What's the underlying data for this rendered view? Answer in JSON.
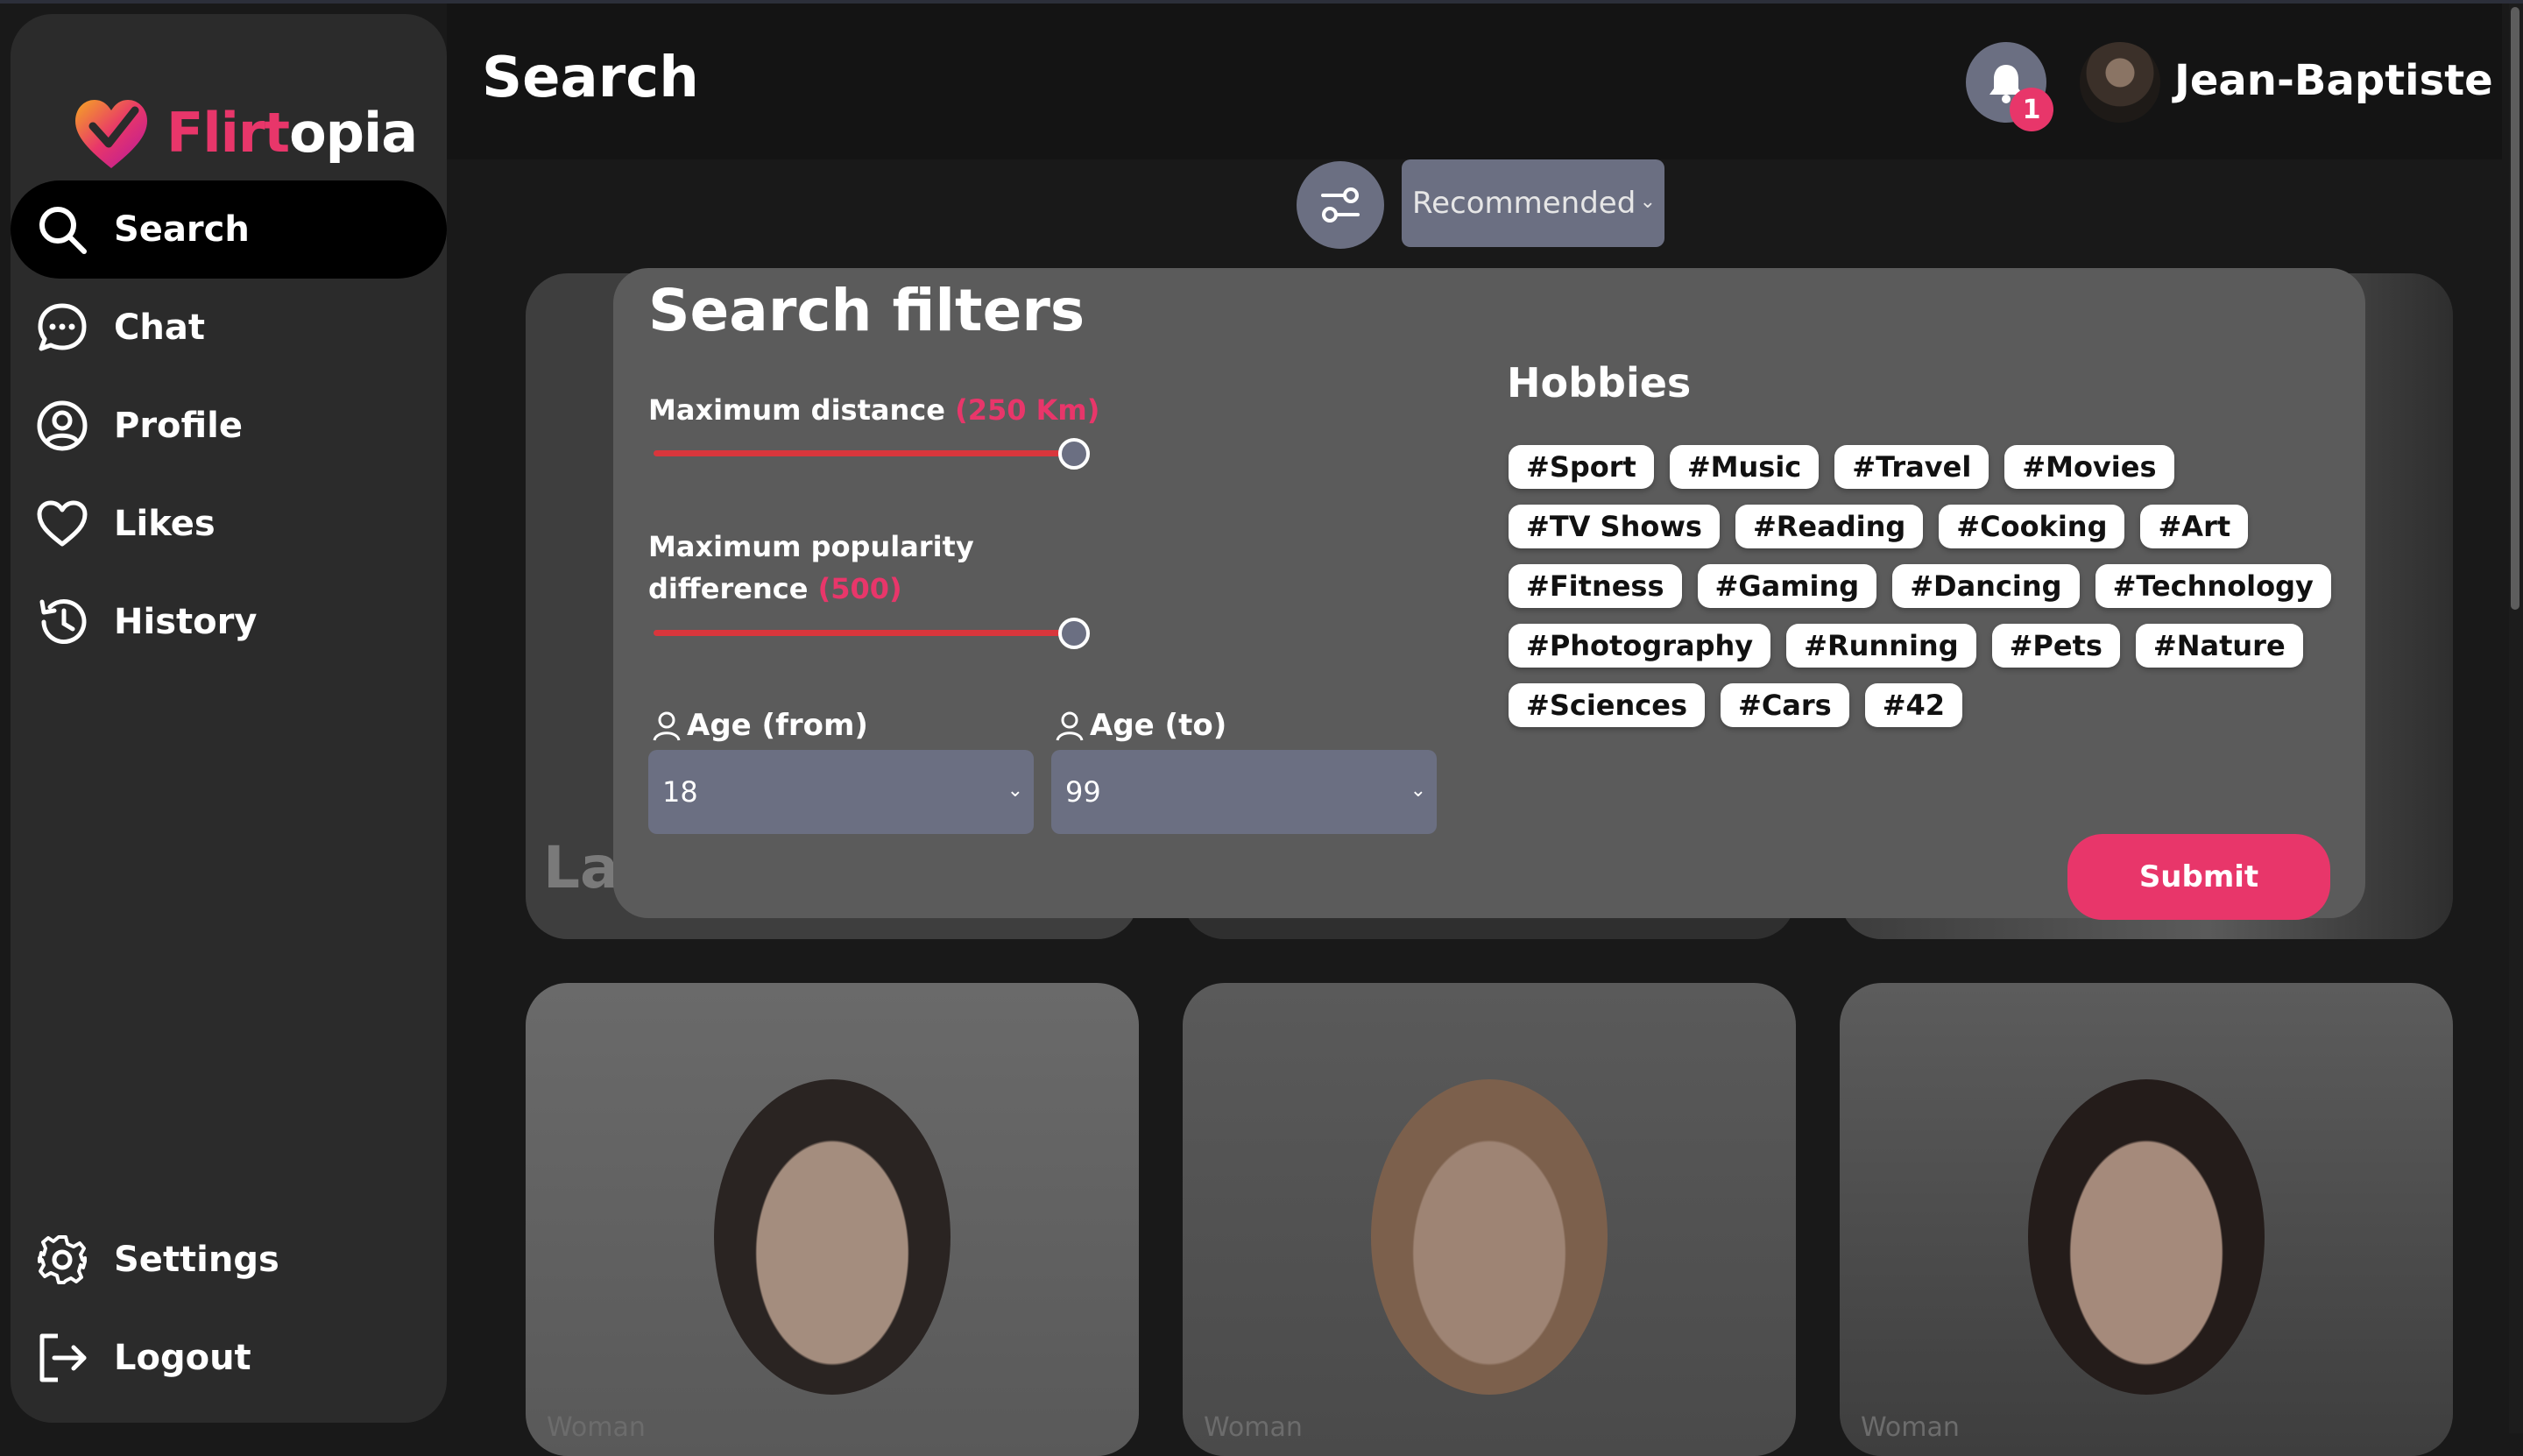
{
  "app": {
    "logo_part1": "Flirt",
    "logo_part2": "opia",
    "brand_color": "#e8366a"
  },
  "sidebar": {
    "items": [
      {
        "label": "Search",
        "icon": "search-icon",
        "active": true
      },
      {
        "label": "Chat",
        "icon": "chat-icon"
      },
      {
        "label": "Profile",
        "icon": "profile-icon"
      },
      {
        "label": "Likes",
        "icon": "heart-icon"
      },
      {
        "label": "History",
        "icon": "history-icon"
      }
    ],
    "bottom_items": [
      {
        "label": "Settings",
        "icon": "gear-icon"
      },
      {
        "label": "Logout",
        "icon": "logout-icon"
      }
    ]
  },
  "header": {
    "title": "Search",
    "notification_count": "1",
    "user_name": "Jean-Baptiste"
  },
  "toolbar": {
    "sort_value": "Recommended"
  },
  "filters": {
    "title": "Search filters",
    "distance": {
      "label": "Maximum distance",
      "value_text": "(250 Km)",
      "fraction": 1.0
    },
    "popularity": {
      "label_line1": "Maximum popularity",
      "label_line2": "difference",
      "value_text": "(500)",
      "fraction": 1.0
    },
    "age_from": {
      "label": "Age (from)",
      "value": "18"
    },
    "age_to": {
      "label": "Age (to)",
      "value": "99"
    },
    "hobbies_title": "Hobbies",
    "hobbies": [
      [
        "#Sport",
        "#Music",
        "#Travel",
        "#Movies"
      ],
      [
        "#TV Shows",
        "#Reading",
        "#Cooking",
        "#Art"
      ],
      [
        "#Fitness",
        "#Gaming",
        "#Dancing",
        "#Technology"
      ],
      [
        "#Photography",
        "#Running",
        "#Pets",
        "#Nature"
      ],
      [
        "#Sciences",
        "#Cars",
        "#42"
      ]
    ],
    "submit_label": "Submit"
  },
  "cards": {
    "peek_name": "La",
    "gender_label": "Woman"
  }
}
